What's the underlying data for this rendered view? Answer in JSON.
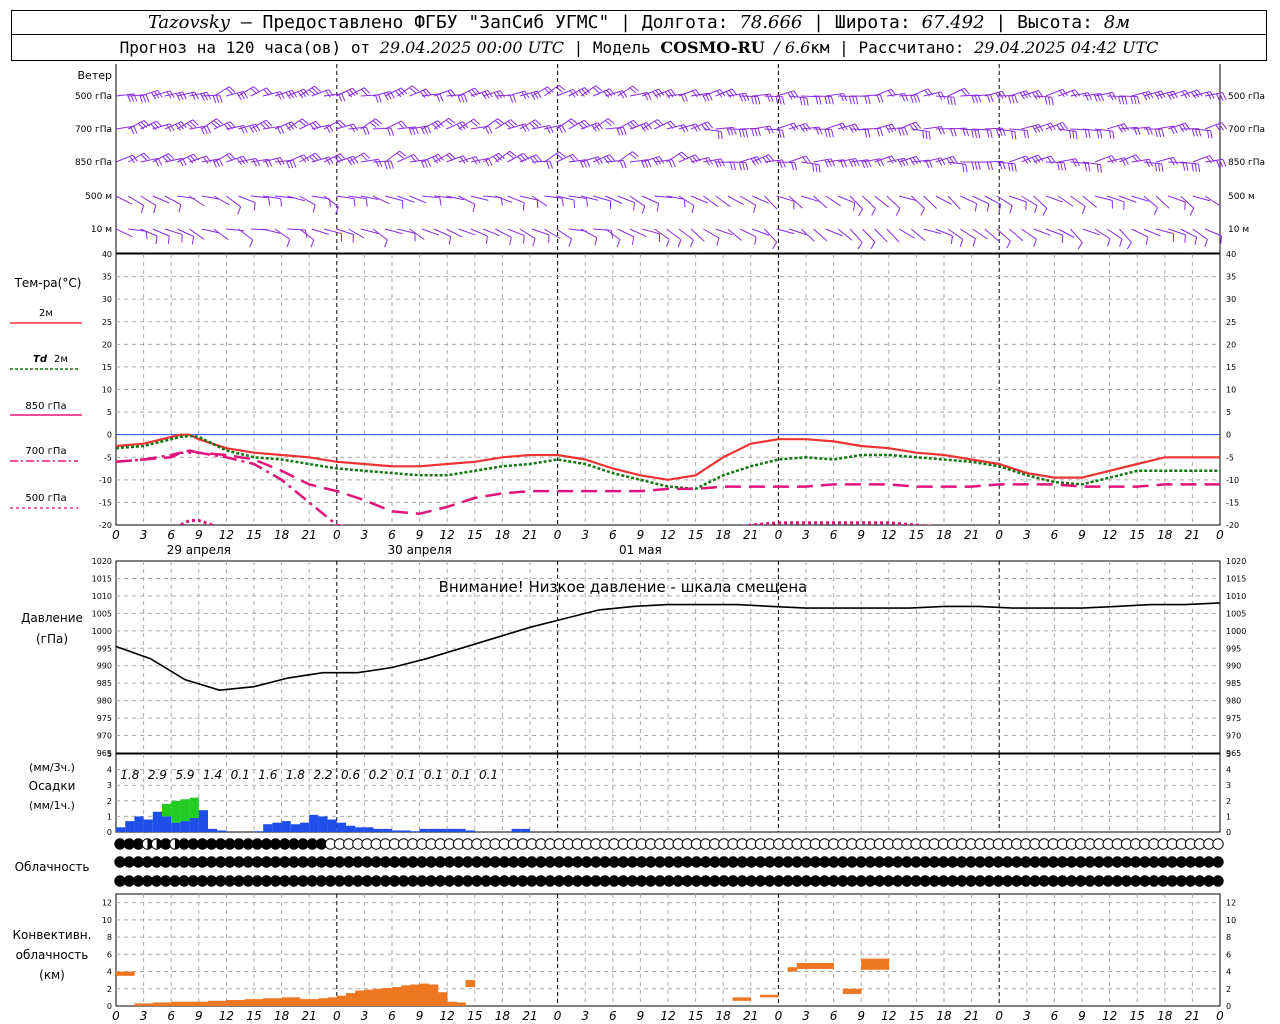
{
  "header": {
    "station": "Tazovsky",
    "provider": "— Предоставлено ФГБУ \"ЗапСиб УГМС\"",
    "lon_label": "Долгота:",
    "lon_value": "78.666",
    "lat_label": "Широта:",
    "lat_value": "67.492",
    "alt_label": "Высота:",
    "alt_value": "8м",
    "forecast_label": "Прогноз на 120 часа(ов) от",
    "forecast_start": "29.04.2025 00:00 UTC",
    "model_label": "Модель",
    "model_name": "COSMO-RU",
    "model_res": "/ 6.6",
    "model_res_unit": "км",
    "calc_label": "Рассчитано:",
    "calc_time": "29.04.2025 04:42 UTC"
  },
  "labels": {
    "wind": "Ветер",
    "wind_levels": [
      "500 гПа",
      "700 гПа",
      "850 гПа",
      "500 м",
      "10 м"
    ],
    "temp_title": "Тем-ра(°C)",
    "temp_2m": "2м",
    "td_prefix": "Td",
    "td_suffix": "2м",
    "t850": "850 гПа",
    "t700": "700 гПа",
    "t500": "500 гПа",
    "pressure_title": "Давление",
    "pressure_unit": "(гПа)",
    "pressure_warning": "Внимание! Низкое давление - шкала смещена",
    "precip_unit3": "(мм/3ч.)",
    "precip_title": "Осадки",
    "precip_unit1": "(мм/1ч.)",
    "cloud_title": "Облачность",
    "conv_title1": "Конвективн.",
    "conv_title2": "облачность",
    "conv_unit": "(км)"
  },
  "colors": {
    "wind": "#8a2be2",
    "t2m": "#ee3333",
    "td2m": "#117711",
    "tlevels": "#e0157a",
    "rain": "#1f4fe8",
    "snow": "#22cc22",
    "convective": "#ee7722"
  },
  "chart_data": [
    {
      "type": "line",
      "panel": "temperature",
      "x_hours": [
        0,
        3,
        6,
        7,
        8,
        9,
        12,
        15,
        18,
        21,
        24,
        27,
        30,
        33,
        36,
        39,
        42,
        45,
        48,
        51,
        54,
        57,
        60,
        63,
        66,
        69,
        72,
        75,
        78,
        81,
        84,
        87,
        90,
        93,
        96,
        99,
        102,
        105,
        108,
        111,
        114,
        117,
        120
      ],
      "ylim": [
        -20,
        40
      ],
      "yticks": [
        40,
        35,
        30,
        25,
        20,
        15,
        10,
        5,
        0,
        -5,
        -10,
        -15,
        -20
      ],
      "series": [
        {
          "name": "2м",
          "style": "solid",
          "values": [
            -2.5,
            -2,
            -0.5,
            0,
            0,
            -1,
            -3,
            -4,
            -4.5,
            -5,
            -6,
            -6.5,
            -7,
            -7,
            -6.5,
            -6,
            -5,
            -4.5,
            -4.5,
            -5.5,
            -7.5,
            -9,
            -10,
            -9,
            -5,
            -2,
            -1,
            -1,
            -1.5,
            -2.5,
            -3,
            -4,
            -4.5,
            -5.5,
            -6.5,
            -8.5,
            -9.5,
            -9.5,
            -8,
            -6.5,
            -5,
            -5,
            -5
          ]
        },
        {
          "name": "Td 2м",
          "style": "dotted",
          "values": [
            -3,
            -2.5,
            -1,
            -0.5,
            -0.3,
            -0.5,
            -3.5,
            -5,
            -5.5,
            -6.5,
            -7.5,
            -8,
            -8.5,
            -9,
            -9,
            -8,
            -7,
            -6.5,
            -5.5,
            -6.5,
            -8.5,
            -10,
            -11.5,
            -12,
            -9,
            -7,
            -5.5,
            -5,
            -5.5,
            -4.5,
            -4.5,
            -5,
            -5.5,
            -6,
            -7,
            -9,
            -10.5,
            -11,
            -9.5,
            -8,
            -8,
            -8,
            -8
          ]
        },
        {
          "name": "850 гПа",
          "style": "dash",
          "values": [
            -6,
            -5.5,
            -5,
            -4,
            -3.5,
            -4,
            -4.5,
            -5.5,
            -8,
            -11,
            -12.5,
            -14.5,
            -17,
            -17.5,
            -16,
            -14,
            -13,
            -12.5,
            -12.5,
            -12.5,
            -12.5,
            -12.5,
            -12,
            -12,
            -11.5,
            -11.5,
            -11.5,
            -11.5,
            -11,
            -11,
            -11,
            -11.5,
            -11.5,
            -11.5,
            -11,
            -11,
            -11,
            -11.5,
            -11.5,
            -11.5,
            -11,
            -11,
            -11
          ]
        },
        {
          "name": "700 гПа",
          "style": "dashdot",
          "values": [
            -6,
            -5.5,
            -4.5,
            -4,
            -4,
            -4,
            -5,
            -6.5,
            -10,
            -15,
            -20,
            -21,
            -21,
            -21,
            -21,
            -21,
            -21,
            -21,
            -21,
            -21,
            -21,
            -21,
            -21,
            -21,
            -21,
            -21,
            -21,
            -21,
            -21,
            -21,
            -21,
            -21,
            -21,
            -21,
            -21,
            -21,
            -21,
            -21,
            -21,
            -21,
            -21,
            -21,
            -21
          ]
        },
        {
          "name": "500 гПа",
          "style": "dots",
          "values": [
            -21,
            -21,
            -21,
            -20,
            -19,
            -19,
            -21,
            -21,
            -21,
            -21,
            -21,
            -21,
            -21,
            -21,
            -21,
            -21,
            -21,
            -21,
            -21,
            -21,
            -21,
            -21,
            -21,
            -21,
            -21,
            -20,
            -19.5,
            -19.5,
            -19.5,
            -19.5,
            -19.5,
            -20,
            -20.5,
            -21,
            -21,
            -21,
            -21,
            -21,
            -21,
            -21,
            -21,
            -21,
            -21
          ]
        }
      ],
      "xticks": [
        "0",
        "3",
        "6",
        "9",
        "12",
        "15",
        "18",
        "21",
        "0",
        "3",
        "6",
        "9",
        "12",
        "15",
        "18",
        "21",
        "0",
        "3",
        "6",
        "9",
        "12",
        "15",
        "18",
        "21",
        "0",
        "3",
        "6"
      ],
      "date_labels": [
        "29 апреля",
        "30 апреля",
        "01 мая"
      ]
    },
    {
      "type": "line",
      "panel": "pressure",
      "x_hours": [
        0,
        3,
        6,
        9,
        12,
        15,
        18,
        21,
        24,
        27,
        30,
        33,
        36,
        39,
        42,
        45,
        48,
        51,
        54,
        57,
        60,
        63,
        66,
        69,
        72,
        75,
        78,
        81,
        84,
        87,
        90,
        93,
        96,
        99,
        102,
        105,
        108,
        111,
        114,
        117,
        120
      ],
      "ylim": [
        965,
        1020
      ],
      "yticks": [
        1020,
        1015,
        1010,
        1005,
        1000,
        995,
        990,
        985,
        980,
        975,
        970,
        965
      ],
      "series": [
        {
          "name": "",
          "values": [
            995.5,
            992,
            986,
            983,
            984,
            986.5,
            988,
            988,
            989.5,
            992,
            995,
            998,
            1001,
            1003.5,
            1006,
            1007,
            1007.5,
            1007.5,
            1007.5,
            1007,
            1006.5,
            1006.5,
            1006.5,
            1006.5,
            1007,
            1007,
            1006.5,
            1006.5,
            1006.5,
            1007,
            1007.5,
            1007.5,
            1008
          ]
        }
      ]
    },
    {
      "type": "bar",
      "panel": "precipitation",
      "ylim": [
        0,
        5
      ],
      "yticks": [
        5,
        4,
        3,
        2,
        1,
        0
      ],
      "sums_3h": [
        "1.8",
        "2.9",
        "5.9",
        "1.4",
        "0.1",
        "1.6",
        "1.8",
        "2.2",
        "0.6",
        "0.2",
        "0.1",
        "0.1",
        "0.1",
        "0.1"
      ],
      "rain_hourly": [
        0.3,
        0.7,
        1.0,
        0.8,
        1.3,
        1.0,
        0.6,
        0.7,
        0.9,
        1.4,
        0.2,
        0.1,
        0,
        0,
        0,
        0.05,
        0.5,
        0.6,
        0.7,
        0.5,
        0.6,
        1.1,
        1.0,
        0.8,
        0.6,
        0.4,
        0.3,
        0.3,
        0.2,
        0.2,
        0.1,
        0.1,
        0.05,
        0.2,
        0.2,
        0.2,
        0.2,
        0.2,
        0.1,
        0,
        0,
        0,
        0,
        0.2,
        0.2,
        0,
        0
      ],
      "snow_hourly": [
        0,
        0,
        0,
        0,
        0,
        0.8,
        1.4,
        1.4,
        1.3,
        0,
        0,
        0,
        0,
        0,
        0,
        0,
        0,
        0,
        0,
        0,
        0,
        0,
        0,
        0,
        0,
        0,
        0,
        0,
        0,
        0,
        0,
        0,
        0,
        0,
        0,
        0,
        0,
        0,
        0,
        0,
        0,
        0,
        0,
        0,
        0,
        0,
        0
      ]
    },
    {
      "type": "table",
      "panel": "cloudiness",
      "rows_oktas": [
        [
          8,
          8,
          8,
          6,
          7,
          8,
          7,
          8,
          8,
          8,
          8,
          8,
          8,
          8,
          8,
          8,
          8,
          8,
          8,
          8,
          8,
          8,
          8,
          0,
          0,
          0,
          0,
          0,
          0,
          0,
          0,
          0,
          0,
          0,
          0,
          0,
          0,
          0,
          0,
          0,
          0,
          0,
          0,
          0,
          0,
          0,
          0,
          0,
          0,
          0,
          0,
          0,
          0,
          0,
          0,
          0,
          0,
          0,
          0,
          0,
          0,
          0,
          0,
          0,
          0,
          0,
          0,
          0,
          0,
          0,
          0,
          0,
          0,
          0,
          0,
          0,
          0,
          0,
          0,
          0,
          0,
          0,
          0,
          0,
          0,
          0,
          0,
          0,
          0,
          0,
          0,
          0,
          0,
          0,
          0,
          0,
          0,
          0,
          0,
          0,
          0,
          0,
          0,
          0,
          0,
          0,
          0,
          0,
          0,
          0,
          0,
          0,
          0,
          0,
          0,
          0,
          0,
          0,
          0,
          0,
          0
        ],
        [
          8,
          8,
          8,
          8,
          8,
          8,
          8,
          8,
          8,
          8,
          8,
          8,
          8,
          8,
          8,
          8,
          8,
          8,
          8,
          8,
          8,
          8,
          8,
          8,
          8,
          8,
          8,
          8,
          8,
          8,
          8,
          8,
          8,
          8,
          8,
          8,
          8,
          8,
          8,
          8,
          8,
          8,
          8,
          8,
          8,
          8,
          8,
          8,
          8,
          8,
          8,
          8,
          8,
          8,
          8,
          8,
          8,
          8,
          8,
          8,
          8,
          8,
          8,
          8,
          8,
          8,
          8,
          8,
          8,
          8,
          8,
          8,
          8,
          8,
          8,
          8,
          8,
          8,
          8,
          8,
          8,
          8,
          8,
          8,
          8,
          8,
          8,
          8,
          8,
          8,
          8,
          8,
          8,
          8,
          8,
          8,
          8,
          8,
          8,
          8,
          8,
          8,
          8,
          8,
          8,
          8,
          8,
          8,
          8,
          8,
          8,
          8,
          8,
          8,
          8,
          8,
          8,
          8,
          8,
          8,
          8
        ],
        [
          8,
          8,
          8,
          8,
          8,
          8,
          8,
          8,
          8,
          8,
          8,
          8,
          8,
          8,
          8,
          8,
          8,
          8,
          8,
          8,
          8,
          8,
          8,
          8,
          8,
          8,
          8,
          8,
          8,
          8,
          8,
          8,
          8,
          8,
          8,
          8,
          8,
          8,
          8,
          8,
          8,
          8,
          8,
          8,
          8,
          8,
          8,
          8,
          8,
          8,
          8,
          8,
          8,
          8,
          8,
          8,
          8,
          8,
          8,
          8,
          8,
          8,
          8,
          8,
          8,
          8,
          8,
          8,
          8,
          8,
          8,
          8,
          8,
          8,
          8,
          8,
          8,
          8,
          8,
          8,
          8,
          8,
          8,
          8,
          8,
          8,
          8,
          8,
          8,
          8,
          8,
          8,
          8,
          8,
          8,
          8,
          8,
          8,
          8,
          8,
          8,
          8,
          8,
          8,
          8,
          8,
          8,
          8,
          8,
          8,
          8,
          8,
          8,
          8,
          8,
          8,
          8,
          8,
          8,
          8,
          8
        ]
      ]
    },
    {
      "type": "bar",
      "panel": "convective",
      "ylim": [
        0,
        13
      ],
      "yticks": [
        12,
        10,
        8,
        6,
        4,
        2,
        0
      ],
      "top_km": [
        4,
        4,
        0.3,
        0.3,
        0.4,
        0.4,
        0.5,
        0.5,
        0.5,
        0.5,
        0.6,
        0.6,
        0.7,
        0.7,
        0.8,
        0.8,
        0.9,
        0.9,
        1.0,
        1.0,
        0.8,
        0.8,
        0.9,
        1.0,
        1.2,
        1.5,
        1.8,
        1.9,
        2.0,
        2.1,
        2.2,
        2.4,
        2.5,
        2.6,
        2.5,
        1.6,
        0.5,
        0.4,
        3,
        0,
        0,
        0,
        0,
        0,
        0,
        0,
        0,
        0,
        0,
        0,
        0,
        0,
        0,
        0,
        0,
        0,
        0,
        0,
        0,
        0,
        0,
        0,
        0,
        0,
        0,
        0,
        0,
        1,
        1,
        0,
        1.3,
        1.3,
        0,
        4.5,
        5,
        5,
        5,
        5,
        0,
        2,
        2,
        5.5,
        5.5,
        5.5,
        0,
        0,
        0,
        0,
        0,
        0,
        0,
        0,
        0,
        0,
        0,
        0,
        0,
        0,
        0,
        0,
        0,
        0,
        0,
        0,
        0,
        0,
        0,
        0,
        0,
        0,
        0,
        0,
        0,
        0,
        0,
        0,
        0,
        0,
        0,
        0
      ],
      "base_km": [
        3.5,
        3.5,
        0,
        0,
        0,
        0,
        0,
        0,
        0,
        0,
        0,
        0,
        0,
        0,
        0,
        0,
        0,
        0,
        0,
        0,
        0,
        0,
        0,
        0,
        0,
        0,
        0,
        0,
        0,
        0,
        0,
        0,
        0,
        0,
        0,
        0,
        0,
        0,
        2.2,
        0,
        0,
        0,
        0,
        0,
        0,
        0,
        0,
        0,
        0,
        0,
        0,
        0,
        0,
        0,
        0,
        0,
        0,
        0,
        0,
        0,
        0,
        0,
        0,
        0,
        0,
        0,
        0,
        0.6,
        0.6,
        0,
        1,
        1,
        0,
        4,
        4.3,
        4.3,
        4.3,
        4.3,
        0,
        1.4,
        1.4,
        4.2,
        4.2,
        4.2,
        0,
        0,
        0,
        0,
        0,
        0,
        0,
        0,
        0,
        0,
        0,
        0,
        0,
        0,
        0,
        0,
        0,
        0,
        0,
        0,
        0,
        0,
        0,
        0,
        0,
        0,
        0,
        0,
        0,
        0,
        0,
        0,
        0,
        0,
        0,
        0
      ]
    }
  ]
}
